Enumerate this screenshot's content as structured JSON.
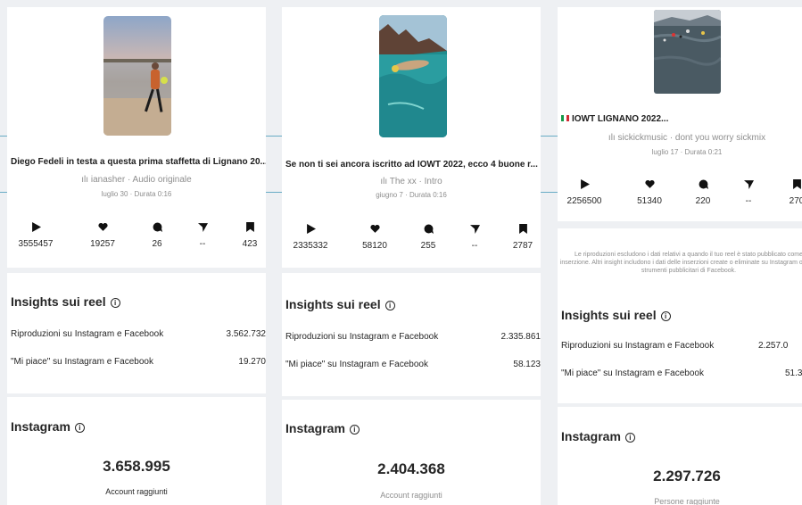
{
  "panels": [
    {
      "title": "Diego Fedeli in testa a questa prima staffetta di Lignano 20...",
      "audio": "ianasher · Audio originale",
      "meta": "luglio 30 · Durata 0:16",
      "stats": {
        "plays": "3555457",
        "likes": "19257",
        "comments": "26",
        "shares": "--",
        "saves": "423"
      },
      "insights_heading": "Insights sui reel",
      "rows": [
        {
          "label": "Riproduzioni su Instagram e Facebook",
          "value": "3.562.732"
        },
        {
          "label": "\"Mi piace\" su Instagram e Facebook",
          "value": "19.270"
        }
      ],
      "instagram_heading": "Instagram",
      "reach_value": "3.658.995",
      "reach_label": "Account raggiunti"
    },
    {
      "title": "Se non ti sei ancora iscritto ad IOWT 2022, ecco 4 buone r...",
      "audio": "The xx · Intro",
      "meta": "giugno 7 · Durata 0:16",
      "stats": {
        "plays": "2335332",
        "likes": "58120",
        "comments": "255",
        "shares": "--",
        "saves": "2787"
      },
      "insights_heading": "Insights sui reel",
      "rows": [
        {
          "label": "Riproduzioni su Instagram e Facebook",
          "value": "2.335.861"
        },
        {
          "label": "\"Mi piace\" su Instagram e Facebook",
          "value": "58.123"
        }
      ],
      "instagram_heading": "Instagram",
      "reach_value": "2.404.368",
      "reach_label": "Account raggiunti"
    },
    {
      "title": "IOWT LIGNANO 2022...",
      "audio": "sickickmusic · dont you worry sickmix",
      "meta": "luglio 17 · Durata 0:21",
      "stats": {
        "plays": "2256500",
        "likes": "51340",
        "comments": "220",
        "shares": "--",
        "saves": "270"
      },
      "note": "Le riproduzioni escludono i dati relativi a quando il tuo reel è stato pubblicato come inserzione. Altri insight includono i dati delle inserzioni create o eliminate su Instagram o sugli strumenti pubblicitari di Facebook.",
      "insights_heading": "Insights sui reel",
      "rows": [
        {
          "label": "Riproduzioni su Instagram e Facebook",
          "value": "2.257.0"
        },
        {
          "label": "\"Mi piace\" su Instagram e Facebook",
          "value": "51.3"
        }
      ],
      "instagram_heading": "Instagram",
      "reach_value": "2.297.726",
      "reach_label": "Persone raggiunte"
    }
  ]
}
